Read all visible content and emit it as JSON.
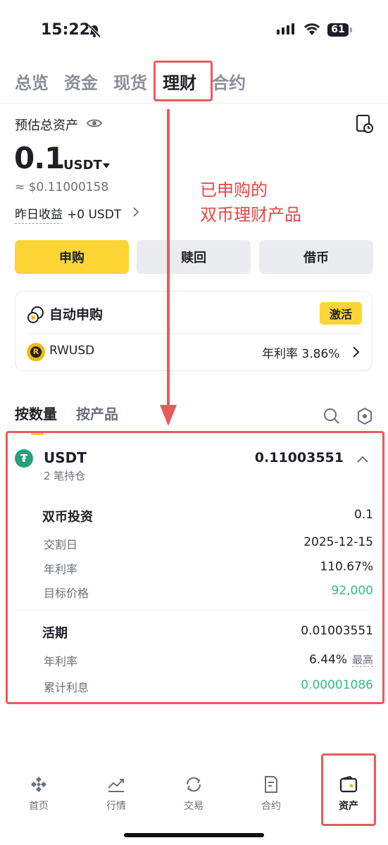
{
  "status": {
    "time": "15:22",
    "battery": "61"
  },
  "tabs": [
    "总览",
    "资金",
    "现货",
    "理财",
    "合约"
  ],
  "summary": {
    "label": "预估总资产",
    "value": "0.1",
    "unit": "USDT",
    "approx": "≈ $0.11000158",
    "yesterday_label": "昨日收益",
    "yesterday_value": "+0 USDT"
  },
  "actions": {
    "subscribe": "申购",
    "redeem": "赎回",
    "borrow": "借币"
  },
  "auto": {
    "title": "自动申购",
    "activate": "激活",
    "coin": "RWUSD",
    "apr_label": "年利率 3.86%"
  },
  "annotation": {
    "line1": "已申购的",
    "line2": "双币理财产品"
  },
  "subtabs": [
    "按数量",
    "按产品"
  ],
  "asset": {
    "name": "USDT",
    "positions": "2 笔持仓",
    "amount": "0.11003551",
    "dual": {
      "title": "双币投资",
      "amount": "0.1",
      "rows": [
        {
          "label": "交割日",
          "value": "2025-12-15"
        },
        {
          "label": "年利率",
          "value": "110.67%"
        },
        {
          "label": "目标价格",
          "value": "92,000"
        }
      ]
    },
    "flexible": {
      "title": "活期",
      "amount": "0.01003551",
      "apr_label": "年利率",
      "apr_value": "6.44%",
      "apr_tag": "最高",
      "interest_label": "累计利息",
      "interest_value": "0.00001086"
    }
  },
  "nav": [
    "首页",
    "行情",
    "交易",
    "合约",
    "资产"
  ],
  "colors": {
    "brand_yellow": "#fcd535",
    "positive_green": "#2ebd85",
    "annotation_red": "#e84545"
  }
}
